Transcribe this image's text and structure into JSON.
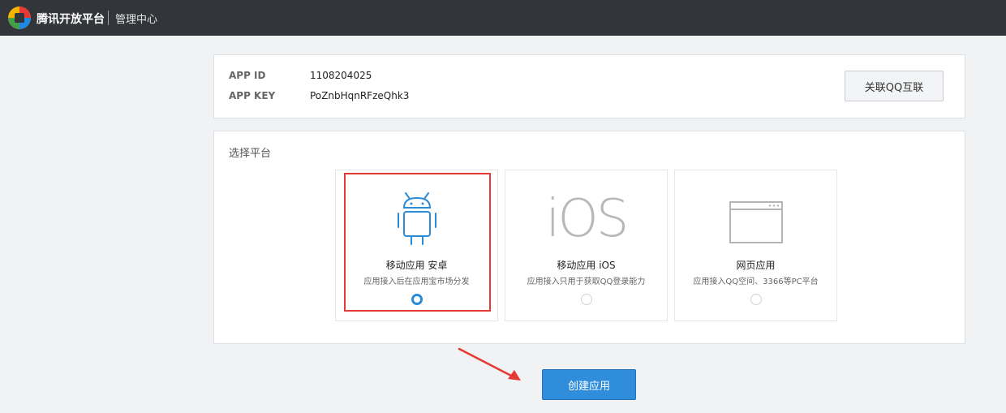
{
  "header": {
    "brand": "腾讯开放平台",
    "section": "管理中心"
  },
  "app": {
    "id_label": "APP ID",
    "id_value": "1108204025",
    "key_label": "APP KEY",
    "key_value": "PoZnbHqnRFzeQhk3",
    "link_button": "关联QQ互联"
  },
  "platform": {
    "title": "选择平台",
    "options": [
      {
        "title": "移动应用 安卓",
        "desc": "应用接入后在应用宝市场分发",
        "selected": true,
        "icon": "android-icon"
      },
      {
        "title": "移动应用 iOS",
        "desc": "应用接入只用于获取QQ登录能力",
        "selected": false,
        "icon": "ios-icon",
        "icon_text": "iOS"
      },
      {
        "title": "网页应用",
        "desc": "应用接入QQ空间、3366等PC平台",
        "selected": false,
        "icon": "browser-window-icon"
      }
    ]
  },
  "actions": {
    "create": "创建应用"
  },
  "colors": {
    "topbar": "#323539",
    "accent": "#2f8ddb",
    "android_icon": "#2a8bd6",
    "highlight": "#e53935"
  }
}
